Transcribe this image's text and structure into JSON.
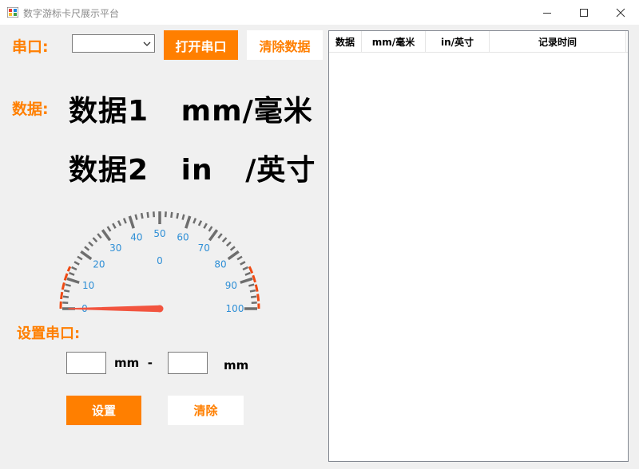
{
  "window": {
    "title": "数字游标卡尺展示平台"
  },
  "serial": {
    "label": "串口:",
    "combo_value": "",
    "open_button": "打开串口",
    "clear_button": "清除数据"
  },
  "data": {
    "label": "数据:",
    "line1": "数据1   mm/毫米",
    "line2": "数据2   in   /英寸"
  },
  "gauge": {
    "value": 0,
    "min": 0,
    "max": 100,
    "value_text": "0",
    "ticks": [
      "0",
      "10",
      "20",
      "30",
      "40",
      "50",
      "60",
      "70",
      "80",
      "90",
      "100"
    ],
    "needle_color": "#f2543f",
    "range_color": "#ef4a14"
  },
  "settings": {
    "label": "设置串口:",
    "min_value": "",
    "unit1": "mm  -",
    "max_value": "",
    "unit2": "mm",
    "set_button": "设置",
    "clear_button": "清除"
  },
  "table": {
    "columns": [
      "数据",
      "mm/毫米",
      "in/英寸",
      "记录时间"
    ],
    "rows": []
  },
  "colors": {
    "accent": "#ff7f00"
  }
}
